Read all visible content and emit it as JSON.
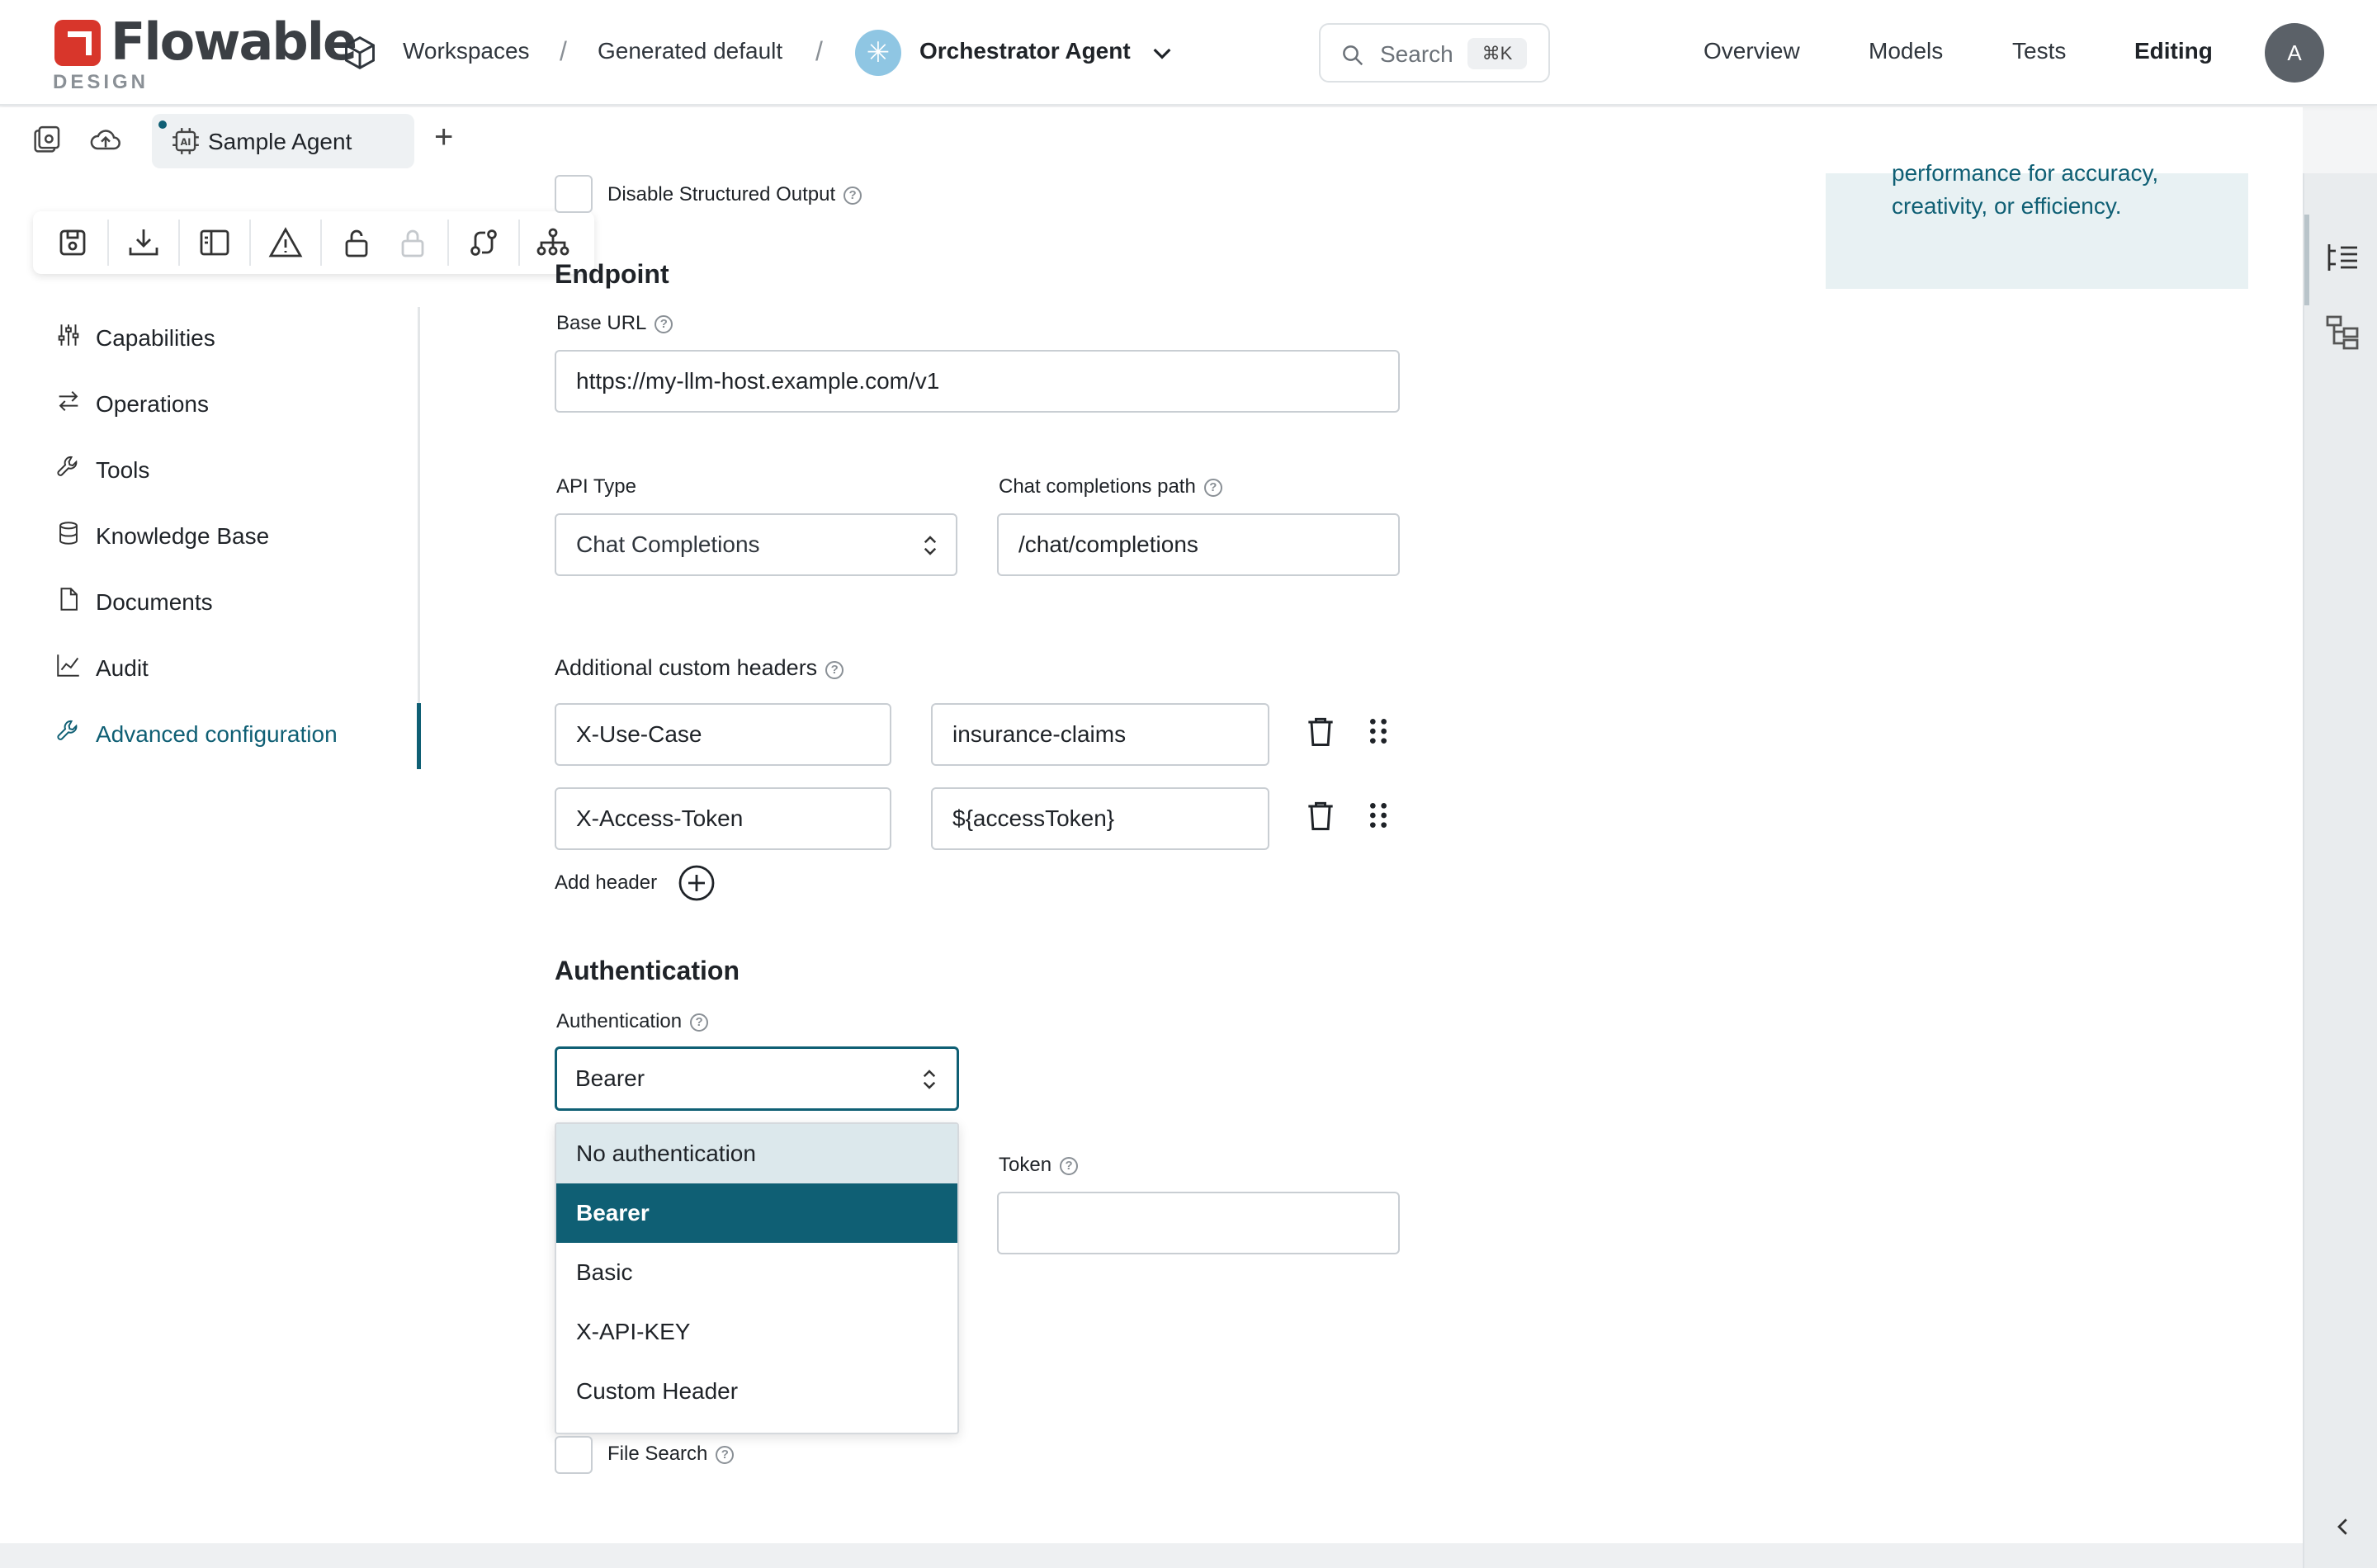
{
  "header": {
    "logo_text": "Flowable",
    "logo_sub": "DESIGN",
    "breadcrumb": [
      "Workspaces",
      "Generated default"
    ],
    "breadcrumb_sep": "/",
    "agent_name": "Orchestrator Agent",
    "search_placeholder": "Search",
    "search_shortcut": "⌘K",
    "nav": [
      "Overview",
      "Models",
      "Tests",
      "Editing"
    ],
    "active_nav": "Editing",
    "avatar": "A"
  },
  "tabs": {
    "active_label": "Sample Agent",
    "add": "+"
  },
  "sidebar": {
    "items": [
      {
        "label": "Capabilities",
        "icon": "sliders-icon"
      },
      {
        "label": "Operations",
        "icon": "arrows-icon"
      },
      {
        "label": "Tools",
        "icon": "wrench-icon"
      },
      {
        "label": "Knowledge Base",
        "icon": "database-icon"
      },
      {
        "label": "Documents",
        "icon": "document-icon"
      },
      {
        "label": "Audit",
        "icon": "chart-icon"
      },
      {
        "label": "Advanced configuration",
        "icon": "wrench-icon"
      }
    ],
    "active": "Advanced configuration"
  },
  "form": {
    "disable_structured_output": "Disable Structured Output",
    "endpoint_title": "Endpoint",
    "base_url_label": "Base URL",
    "base_url_value": "https://my-llm-host.example.com/v1",
    "api_type_label": "API Type",
    "api_type_value": "Chat Completions",
    "chat_path_label": "Chat completions path",
    "chat_path_value": "/chat/completions",
    "headers_label": "Additional custom headers",
    "headers": [
      {
        "key": "X-Use-Case",
        "value": "insurance-claims"
      },
      {
        "key": "X-Access-Token",
        "value": "${accessToken}"
      }
    ],
    "add_header": "Add header",
    "auth_title": "Authentication",
    "auth_label": "Authentication",
    "auth_value": "Bearer",
    "token_label": "Token",
    "file_search": "File Search"
  },
  "auth_options": [
    "No authentication",
    "Bearer",
    "Basic",
    "X-API-KEY",
    "Custom Header"
  ],
  "auth_selected": "Bearer",
  "info_text": "performance for accuracy, creativity, or efficiency.",
  "colors": {
    "accent": "#0f5f74",
    "hover": "#dce8ec",
    "logo_red": "#d8362b"
  }
}
